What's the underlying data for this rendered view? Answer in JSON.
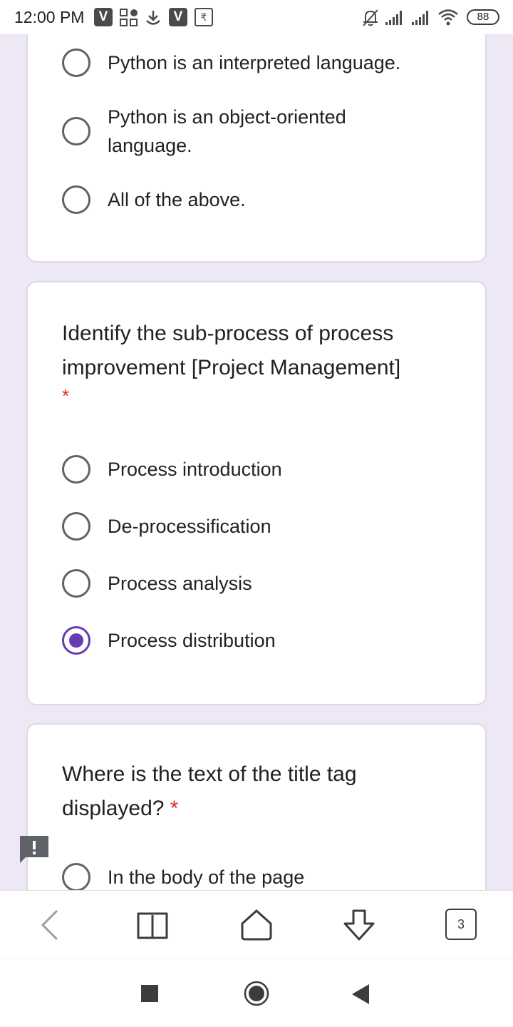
{
  "status_bar": {
    "time": "12:00 PM",
    "rupee_label": "₹",
    "battery": "88",
    "icons": [
      "v-app-icon",
      "apps-icon",
      "download-icon",
      "v-app-icon",
      "rupee-icon",
      "mute-icon",
      "signal-icon",
      "signal-icon",
      "wifi-icon",
      "battery-icon"
    ]
  },
  "form": {
    "previous_question": {
      "options": [
        {
          "label": "Python is an interpreted language.",
          "selected": false
        },
        {
          "label": "Python is an object-oriented language.",
          "selected": false
        },
        {
          "label": "All of the above.",
          "selected": false
        }
      ]
    },
    "question_2": {
      "title": "Identify the sub-process of process improvement [Project Management]",
      "required_marker": "*",
      "options": [
        {
          "label": "Process introduction",
          "selected": false
        },
        {
          "label": "De-processification",
          "selected": false
        },
        {
          "label": "Process analysis",
          "selected": false
        },
        {
          "label": "Process distribution",
          "selected": true
        }
      ]
    },
    "question_3": {
      "title": "Where is the text of the title tag displayed?",
      "required_marker": "*",
      "options": [
        {
          "label": "In the body of the page",
          "selected": false
        }
      ]
    },
    "feedback_icon": "report-icon",
    "accent_color": "#673ab7",
    "required_color": "#d93025",
    "background_color": "#ede7f6"
  },
  "browser_toolbar": {
    "icons": [
      "back-icon",
      "bookmarks-icon",
      "home-icon",
      "download-icon"
    ],
    "tab_count": "3"
  },
  "nav_bar": {
    "icons": [
      "recents-icon",
      "home-icon",
      "back-icon"
    ]
  }
}
